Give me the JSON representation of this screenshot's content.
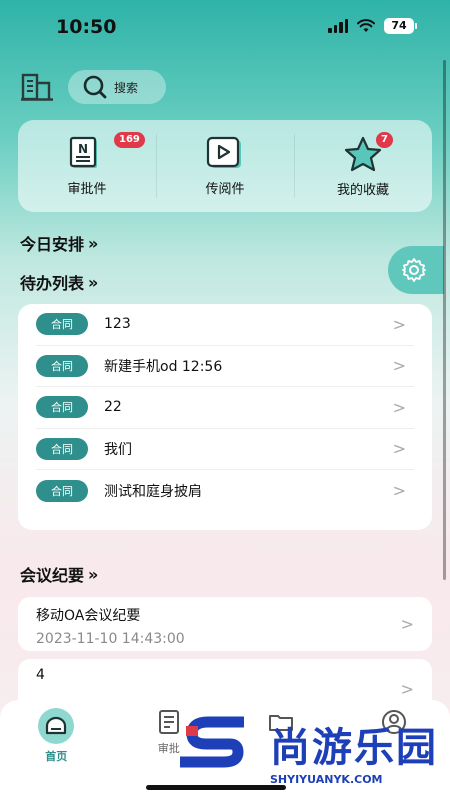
{
  "status_bar": {
    "time": "10:50",
    "battery": "74"
  },
  "header": {
    "search_label": "搜索"
  },
  "shortcuts": [
    {
      "label": "审批件",
      "badge": "169",
      "icon": "document-n-icon"
    },
    {
      "label": "传阅件",
      "badge": "",
      "icon": "play-card-icon"
    },
    {
      "label": "我的收藏",
      "badge": "7",
      "icon": "star-icon"
    }
  ],
  "sections": {
    "today": "今日安排",
    "todo": "待办列表",
    "meetings": "会议纪要",
    "more_icon": "»"
  },
  "todo_items": [
    {
      "tag": "合同",
      "text": "123"
    },
    {
      "tag": "合同",
      "text": "新建手机od 12:56"
    },
    {
      "tag": "合同",
      "text": "22"
    },
    {
      "tag": "合同",
      "text": "我们"
    },
    {
      "tag": "合同",
      "text": "测试和庭身披肩"
    }
  ],
  "meetings": [
    {
      "title": "移动OA会议纪要",
      "time": "2023-11-10 14:43:00"
    },
    {
      "title": "4",
      "time": ""
    }
  ],
  "tabbar": [
    {
      "label": "首页",
      "icon": "home-icon",
      "active": true
    },
    {
      "label": "审批",
      "icon": "doc-list-icon",
      "active": false
    },
    {
      "label": "",
      "icon": "folder-icon",
      "active": false
    },
    {
      "label": "",
      "icon": "user-icon",
      "active": false
    }
  ],
  "watermark": {
    "text": "尚游乐园",
    "url": "SHYIYUANYK.COM"
  },
  "colors": {
    "accent": "#2e8f8c",
    "badge": "#e0394a",
    "watermark": "#1d3fb8"
  }
}
